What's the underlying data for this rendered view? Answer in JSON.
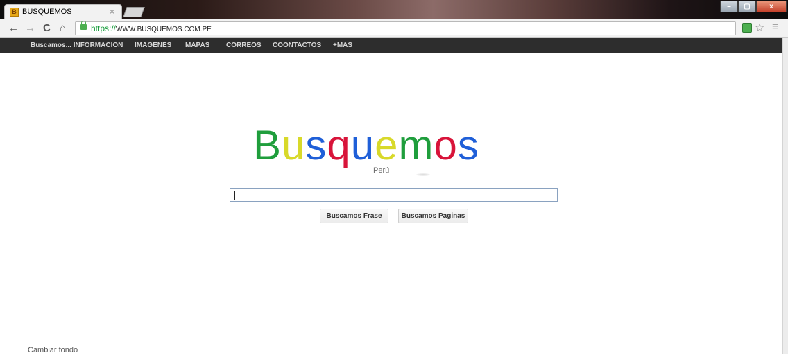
{
  "browser": {
    "tab_title": "BUSQUEMOS",
    "tab_close": "×",
    "url_scheme": "https://",
    "url_host": "WWW.BUSQUEMOS.COM.PE",
    "back_icon": "←",
    "forward_icon": "→",
    "reload_icon": "C",
    "home_icon": "⌂",
    "star_icon": "☆",
    "menu_icon": "≡",
    "window_minimize": "–",
    "window_restore": "▢",
    "window_close": "x"
  },
  "sitenav": {
    "items": [
      {
        "label": "Buscamos... INFORMACION"
      },
      {
        "label": "IMAGENES"
      },
      {
        "label": "MAPAS"
      },
      {
        "label": "CORREOS"
      },
      {
        "label": "COONTACTOS"
      },
      {
        "label": "+MAS"
      }
    ]
  },
  "logo": {
    "letters": [
      {
        "ch": "B",
        "color": "#1f9e3c"
      },
      {
        "ch": "u",
        "color": "#d8d92a"
      },
      {
        "ch": "s",
        "color": "#1f5fd8"
      },
      {
        "ch": "q",
        "color": "#d8143a"
      },
      {
        "ch": "u",
        "color": "#1f5fd8"
      },
      {
        "ch": "e",
        "color": "#d8d92a"
      },
      {
        "ch": "m",
        "color": "#1f9e3c"
      },
      {
        "ch": "o",
        "color": "#d8143a"
      },
      {
        "ch": "s",
        "color": "#1f5fd8"
      }
    ],
    "subtitle": "Perú"
  },
  "search": {
    "value": ""
  },
  "buttons": {
    "phrase": "Buscamos Frase",
    "pages": "Buscamos Paginas"
  },
  "footer": {
    "change_background": "Cambiar fondo"
  }
}
